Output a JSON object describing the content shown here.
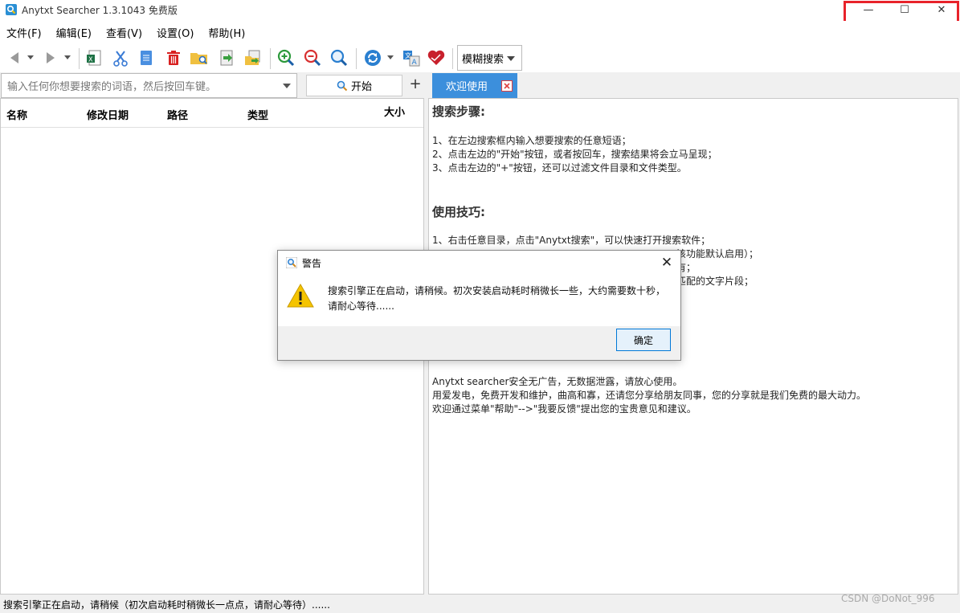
{
  "window": {
    "title": "Anytxt Searcher 1.3.1043 免费版",
    "controls": {
      "minimize": "—",
      "maximize": "☐",
      "close": "✕"
    }
  },
  "menu": [
    "文件(F)",
    "编辑(E)",
    "查看(V)",
    "设置(O)",
    "帮助(H)"
  ],
  "toolbar": {
    "search_mode": "模糊搜索"
  },
  "search": {
    "placeholder": "输入任何你想要搜索的词语，然后按回车键。",
    "start_label": "开始",
    "plus_label": "+"
  },
  "tabs": [
    {
      "label": "欢迎使用",
      "active": true
    }
  ],
  "results": {
    "columns": [
      "名称",
      "修改日期",
      "路径",
      "类型",
      "大小"
    ]
  },
  "welcome": {
    "heading_steps": "搜索步骤:",
    "steps": [
      "1、在左边搜索框内输入想要搜索的任意短语；",
      "2、点击左边的\"开始\"按钮，或者按回车，搜索结果将会立马呈现；",
      "3、点击左边的\"+\"按钮，还可以过滤文件目录和文件类型。"
    ],
    "heading_tips": "使用技巧:",
    "tips_visible": [
      "1、右击任意目录，点击\"Anytxt搜索\"，可以快速打开搜索软件；",
      "该功能默认启用）；",
      "有；",
      "匹配的文字片段；"
    ],
    "footer": [
      "Anytxt searcher安全无广告，无数据泄露，请放心使用。",
      "用爱发电，免费开发和维护，曲高和寡，还请您分享给朋友同事，您的分享就是我们免费的最大动力。",
      "欢迎通过菜单\"帮助\"-->\"我要反馈\"提出您的宝贵意见和建议。"
    ]
  },
  "dialog": {
    "title": "警告",
    "message": "搜索引擎正在启动，请稍候。初次安装启动耗时稍微长一些，大约需要数十秒，请耐心等待......",
    "ok_label": "确定",
    "close_glyph": "✕"
  },
  "status": {
    "text": "搜索引擎正在启动，请稍候（初次启动耗时稍微长一点点，请耐心等待）......"
  },
  "watermark": "CSDN @DoNot_996",
  "colors": {
    "accent": "#3c8fdc",
    "highlight_box": "#e8222a",
    "warning": "#f5c400"
  }
}
